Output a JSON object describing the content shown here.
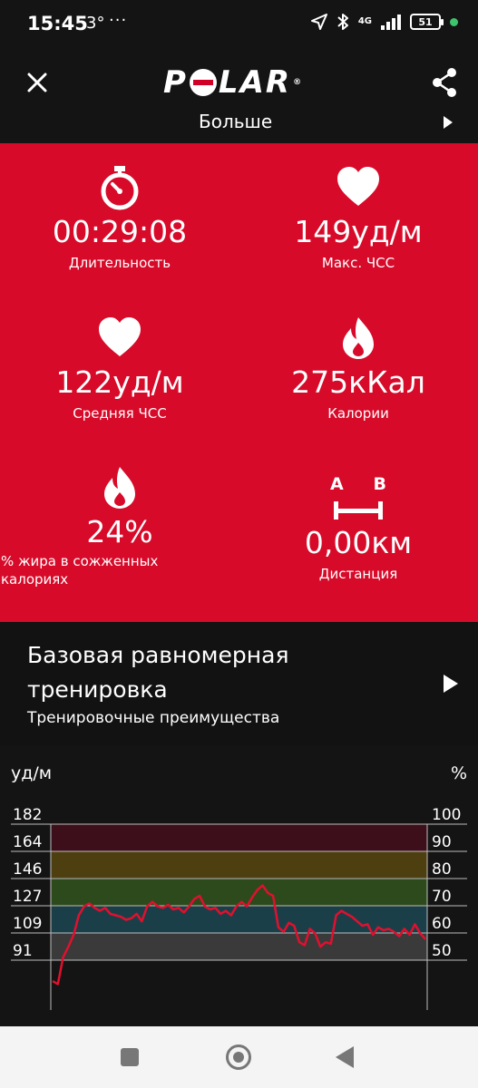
{
  "status_bar": {
    "time": "15:45",
    "temperature": "3°",
    "more": "···",
    "network": "4G",
    "battery": "51"
  },
  "app_bar": {
    "logo_text": [
      "P",
      "L",
      "A",
      "R"
    ],
    "logo_reg": "®"
  },
  "more_row": {
    "label": "Больше"
  },
  "summary": {
    "duration": {
      "value": "00:29:08",
      "label": "Длительность",
      "icon": "stopwatch-icon"
    },
    "max_hr": {
      "value": "149уд/м",
      "label": "Макс. ЧСС",
      "icon": "heart-icon"
    },
    "avg_hr": {
      "value": "122уд/м",
      "label": "Средняя ЧСС",
      "icon": "heart-icon"
    },
    "calories": {
      "value": "275кКал",
      "label": "Калории",
      "icon": "flame-icon"
    },
    "fat_burn": {
      "value": "24%",
      "label_line1": "% жира в сожженных",
      "label_line2": "калориях",
      "icon": "flame-icon"
    },
    "distance": {
      "value": "0,00км",
      "label": "Дистанция",
      "icon": "distance-ab-icon",
      "icon_a": "A",
      "icon_b": "B"
    }
  },
  "benefit": {
    "title_line1": "Базовая равномерная",
    "title_line2": "тренировка",
    "subtitle": "Тренировочные преимущества"
  },
  "chart_data": {
    "type": "line",
    "ylabel": "уд/м",
    "y2label": "%",
    "y_ticks": [
      "182",
      "164",
      "146",
      "127",
      "109",
      "91"
    ],
    "y2_ticks": [
      "100",
      "90",
      "80",
      "70",
      "60",
      "50"
    ],
    "ylim": [
      91,
      182
    ],
    "zones": [
      {
        "from": 91,
        "to": 109,
        "color": "#3a3a3a"
      },
      {
        "from": 109,
        "to": 127,
        "color": "#1b3f49"
      },
      {
        "from": 127,
        "to": 146,
        "color": "#2d4a1d"
      },
      {
        "from": 146,
        "to": 164,
        "color": "#4e3f10"
      },
      {
        "from": 164,
        "to": 182,
        "color": "#3d0f1b"
      }
    ],
    "line_color": "#e1102e",
    "series": [
      {
        "values": [
          77,
          75,
          93,
          100,
          108,
          121,
          127,
          129,
          126,
          124,
          126,
          122,
          121,
          120,
          118,
          119,
          122,
          117,
          127,
          130,
          127,
          126,
          128,
          125,
          126,
          123,
          127,
          132,
          134,
          127,
          125,
          126,
          122,
          124,
          121,
          127,
          130,
          127,
          133,
          138,
          141,
          136,
          134,
          113,
          110,
          116,
          114,
          103,
          101,
          112,
          109,
          100,
          103,
          102,
          121,
          124,
          122,
          120,
          117,
          114,
          115,
          108,
          113,
          111,
          112,
          110,
          107,
          112,
          108,
          115,
          109,
          105
        ]
      }
    ]
  }
}
